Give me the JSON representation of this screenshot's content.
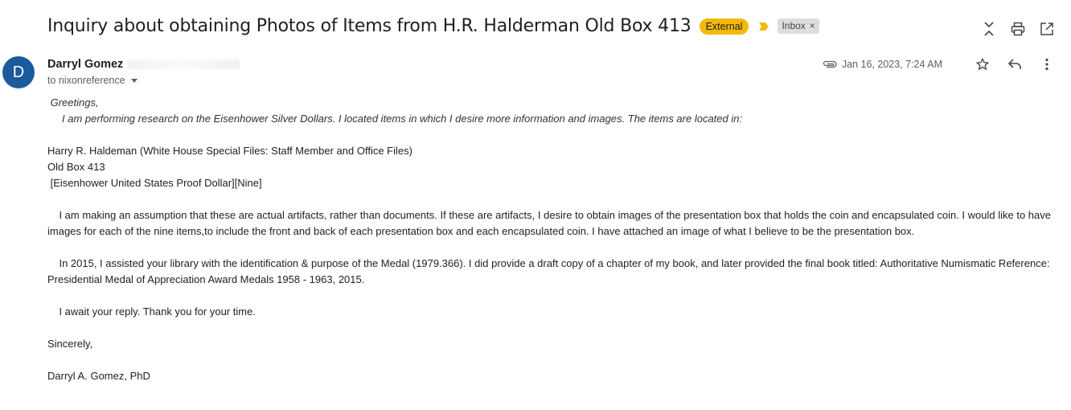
{
  "email": {
    "subject": "Inquiry about obtaining Photos of Items from H.R. Halderman Old Box 413",
    "badge_external": "External",
    "label_inbox": "Inbox",
    "label_remove": "×",
    "sender_initial": "D",
    "sender_name": "Darryl Gomez",
    "to_text": "to nixonreference",
    "date": "Jan 16, 2023, 7:24 AM"
  },
  "body": {
    "greeting": " Greetings,",
    "intro": "I am performing research on the Eisenhower Silver Dollars. I located items in which I desire more information and images. The items are located in:",
    "loc1": "Harry R. Haldeman (White House Special Files: Staff Member and Office Files)",
    "loc2": "Old Box 413",
    "loc3": " [Eisenhower United States Proof Dollar][Nine]",
    "para1": "    I am making an assumption that these are actual artifacts, rather than documents. If these are artifacts, I desire to obtain images of the presentation box that holds the coin and encapsulated coin. I would like to have images for each of the nine items,to include the front and back of each presentation box and each encapsulated coin. I have attached an image of what I believe to be the presentation box.",
    "para2": "    In 2015, I assisted your library with the identification & purpose of the Medal (1979.366). I did provide a draft copy of a chapter of my book, and later provided the final book titled: Authoritative Numismatic Reference: Presidential Medal of Appreciation Award Medals 1958 - 1963, 2015.",
    "para3": "    I await your reply. Thank you for your time.",
    "closing": "Sincerely,",
    "signature": "Darryl A. Gomez, PhD"
  },
  "colors": {
    "external_badge": "#f2b90b",
    "avatar": "#1a5b9c",
    "importance_marker": "#f2b90b"
  }
}
